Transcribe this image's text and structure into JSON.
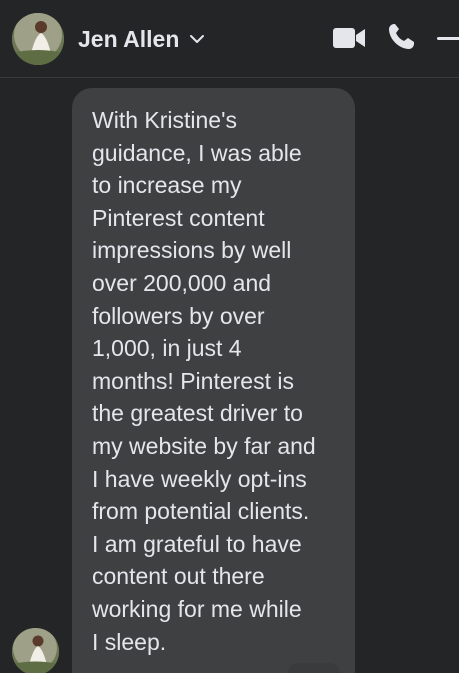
{
  "header": {
    "contact_name": "Jen Allen",
    "icons": [
      "chevron-down-icon",
      "video-call-icon",
      "phone-call-icon",
      "minimize-icon"
    ]
  },
  "message": {
    "text": "With Kristine's\nguidance, I was able\nto increase my\nPinterest content\nimpressions by well\nover 200,000 and\nfollowers by over\n1,000, in just 4\nmonths! Pinterest is\nthe greatest driver to\nmy website by far and\nI have weekly opt-ins\nfrom potential clients.\nI am grateful to have\ncontent out there\nworking for me while\nI sleep."
  },
  "colors": {
    "background": "#242526",
    "bubble": "#3e4042",
    "text": "#e4e6eb",
    "icon": "#e4e6eb"
  }
}
